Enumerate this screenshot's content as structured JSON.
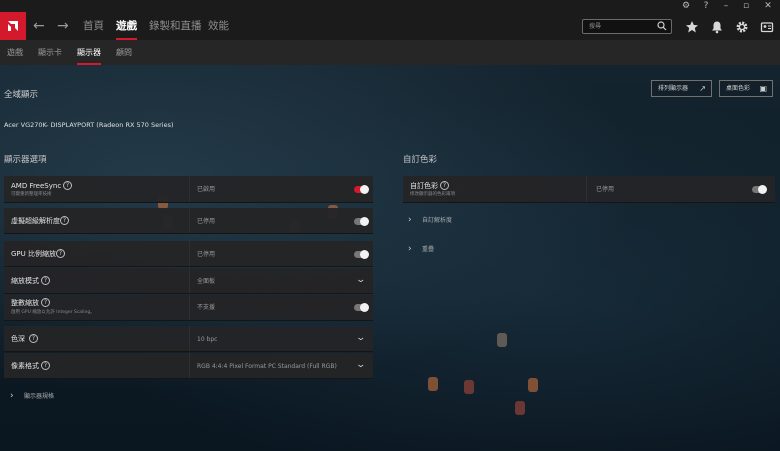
{
  "window": {
    "controls": [
      "bug-icon",
      "help-icon",
      "minimize-icon",
      "restore-icon",
      "close-icon"
    ]
  },
  "topnav": {
    "tabs": [
      {
        "label": "首頁"
      },
      {
        "label": "遊戲"
      },
      {
        "label": "錄製和直播"
      },
      {
        "label": "效能"
      }
    ],
    "active_tab": "遊戲",
    "search_placeholder": "搜尋"
  },
  "subnav": {
    "tabs": [
      {
        "label": "遊戲"
      },
      {
        "label": "顯示卡"
      },
      {
        "label": "顯示器"
      },
      {
        "label": "顧問"
      }
    ],
    "active_tab": "顯示器"
  },
  "page": {
    "title": "全域顯示",
    "buttons": [
      {
        "label": "排列顯示器"
      },
      {
        "label": "桌面色彩"
      }
    ],
    "monitor_name": "Acer VG270K- DISPLAYPORT (Radeon RX 570 Series)"
  },
  "display_options": {
    "title": "顯示器選項",
    "rows": [
      {
        "label": "AMD FreeSync",
        "sub": "可變重新整理率技術",
        "value": "已啟用",
        "control": "toggle",
        "on": true
      },
      {
        "label": "虛擬超級解析度",
        "sub": "",
        "value": "已停用",
        "control": "toggle",
        "on": false
      },
      {
        "label": "GPU 比例縮放",
        "sub": "",
        "value": "已停用",
        "control": "toggle",
        "on": false
      },
      {
        "label": "縮放模式",
        "sub": "",
        "value": "全面板",
        "control": "dropdown"
      },
      {
        "label": "整數縮放",
        "sub": "啟用 GPU 縮放以允許 Integer Scaling。",
        "value": "不支援",
        "control": "toggle",
        "on": false
      },
      {
        "label": "色深",
        "sub": "",
        "value": "10 bpc",
        "control": "dropdown"
      },
      {
        "label": "像素格式",
        "sub": "",
        "value": "RGB 4:4:4 Pixel Format PC Standard (Full RGB)",
        "control": "dropdown"
      }
    ],
    "footer_expand": "顯示器規格"
  },
  "custom_color": {
    "title": "自訂色彩",
    "row": {
      "label": "自訂色彩",
      "sub": "修改顯示器的色彩兩項",
      "value": "已停用",
      "on": false
    },
    "expand_items": [
      {
        "label": "自訂解析度"
      },
      {
        "label": "重疊"
      }
    ]
  },
  "colors": {
    "accent": "#d5192c",
    "card_bg": "#242426",
    "topbar_bg": "#1b1b1b"
  }
}
